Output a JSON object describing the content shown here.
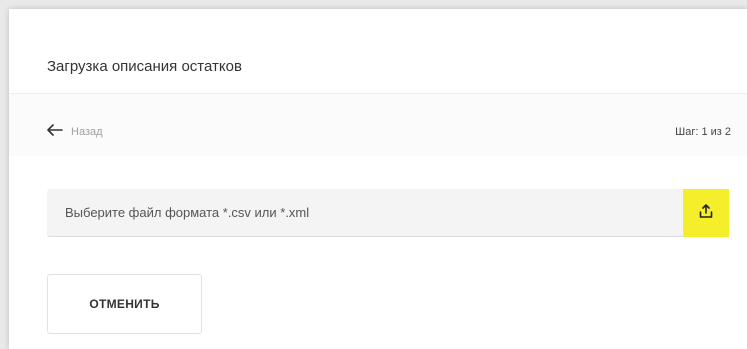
{
  "header": {
    "title": "Загрузка описания остатков"
  },
  "nav": {
    "back_label": "Назад",
    "step_text": "Шаг: 1 из 2"
  },
  "file_picker": {
    "placeholder": "Выберите файл формата *.csv или *.xml",
    "upload_icon": "upload-icon",
    "accent_color": "#f5ee2a"
  },
  "actions": {
    "cancel_label": "ОТМЕНИТЬ"
  }
}
